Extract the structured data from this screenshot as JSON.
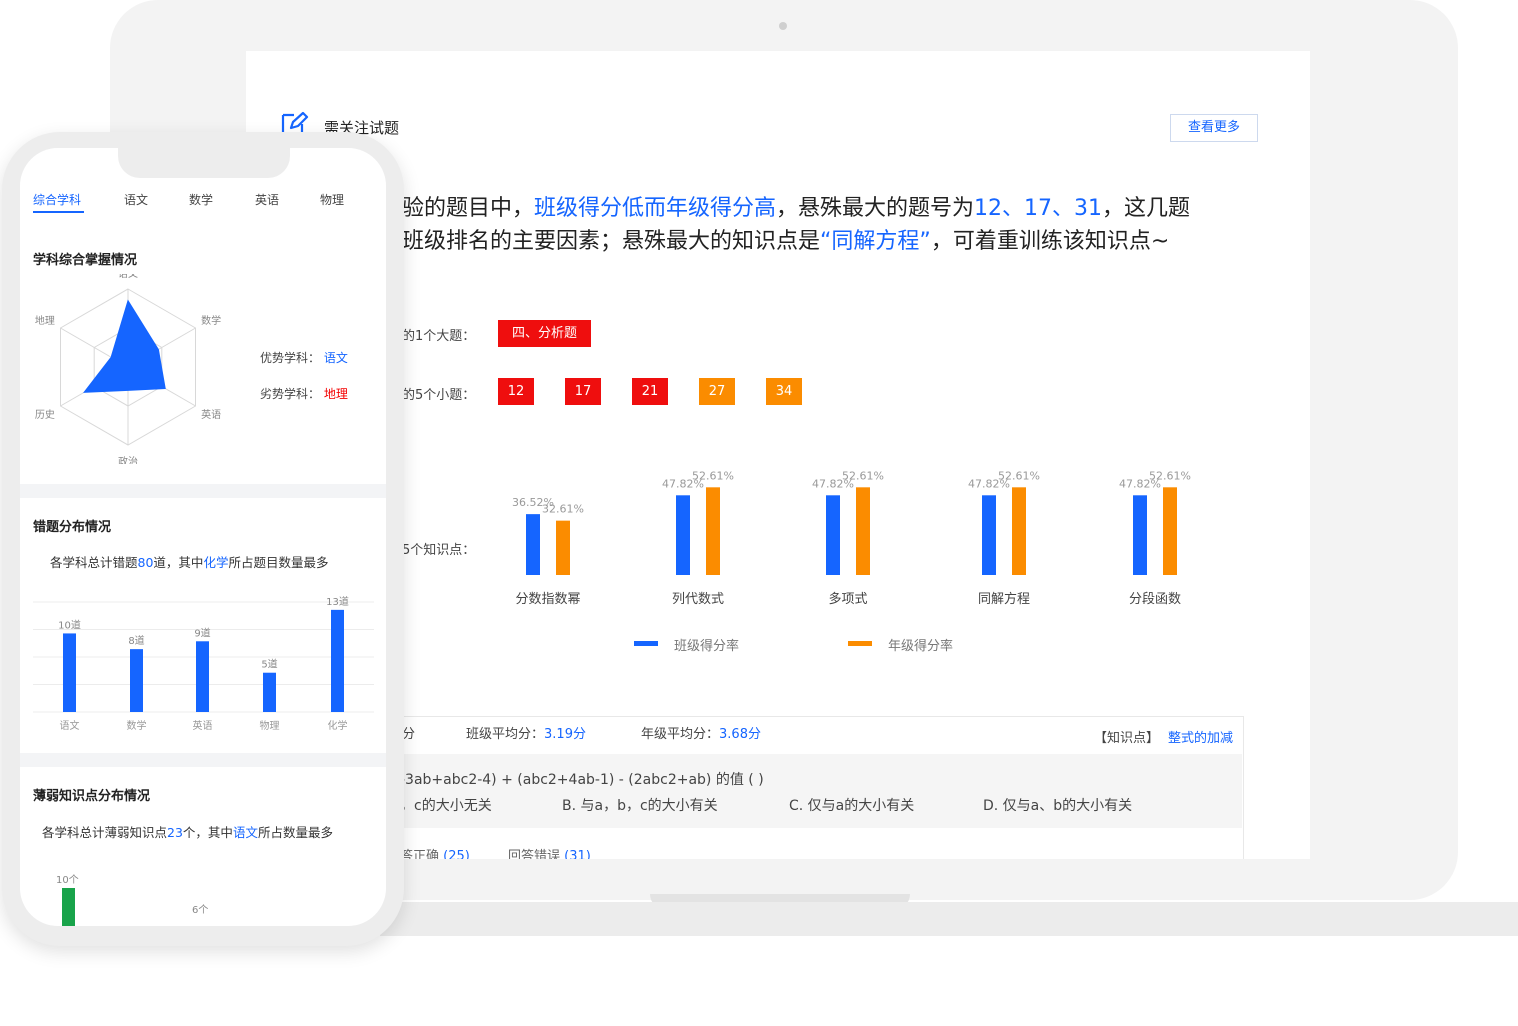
{
  "laptop": {
    "panel_title": "需关注试题",
    "view_more": "查看更多",
    "insight": {
      "l1_a": "验的题目中，",
      "l1_b": "班级得分低而年级得分高",
      "l1_c": "，悬殊最大的题号为",
      "l1_d": "12、17、31",
      "l1_e": "，这几题",
      "l2_a": "班级排名的主要因素；悬殊最大的知识点是",
      "l2_b": "“同解方程”",
      "l2_c": "，可着重训练该知识点~"
    },
    "big_q_label": "的1个大题：",
    "big_q_badge": "四、分析题",
    "small_q_label": "的5个小题：",
    "small_q_badges": [
      {
        "text": "12",
        "color": "red"
      },
      {
        "text": "17",
        "color": "red"
      },
      {
        "text": "21",
        "color": "red"
      },
      {
        "text": "27",
        "color": "orange"
      },
      {
        "text": "34",
        "color": "orange"
      }
    ],
    "kp_label": "5个知识点：",
    "legend_class": "班级得分率",
    "legend_grade": "年级得分率",
    "stats": {
      "partial": "分",
      "class_avg_label": "班级平均分：",
      "class_avg_value": "3.19分",
      "grade_avg_label": "年级平均分：",
      "grade_avg_value": "3.68分",
      "kp_tag": "【知识点】",
      "kp_link": "整式的加减"
    },
    "question": {
      "stem": "-3ab+abc2-4) + (abc2+4ab-1) - (2abc2+ab) 的值 (    )",
      "opt_a": "，c的大小无关",
      "opt_b": "B. 与a，b，c的大小有关",
      "opt_c": "C. 仅与a的大小有关",
      "opt_d": "D. 仅与a、b的大小有关"
    },
    "answer": {
      "correct_label": "答正确",
      "correct_count": "(25)",
      "wrong_label": "回答错误",
      "wrong_count": "(31)"
    }
  },
  "phone": {
    "tabs": [
      "综合学科",
      "语文",
      "数学",
      "英语",
      "物理"
    ],
    "active_tab": 0,
    "mastery": {
      "title": "学科综合掌握情况",
      "strong_label": "优势学科：",
      "strong_value": "语文",
      "weak_label": "劣势学科：",
      "weak_value": "地理"
    },
    "wrong": {
      "title": "错题分布情况",
      "d1": "各学科总计错题",
      "d2": "80",
      "d3": "道，其中",
      "d4": "化学",
      "d5": "所占题目数量最多"
    },
    "weak": {
      "title": "薄弱知识点分布情况",
      "d1": "各学科总计薄弱知识点",
      "d2": "23",
      "d3": "个，其中",
      "d4": "语文",
      "d5": "所占数量最多",
      "bars": [
        {
          "label": "10个",
          "value": 10,
          "color": "#18a34a"
        },
        {
          "label": "6个",
          "value": 6,
          "color": "#18a34a"
        }
      ]
    }
  },
  "chart_data": [
    {
      "type": "bar",
      "categories": [
        "分数指数幂",
        "列代数式",
        "多项式",
        "同解方程",
        "分段函数"
      ],
      "series": [
        {
          "name": "班级得分率",
          "values": [
            36.52,
            47.82,
            47.82,
            47.82,
            47.82
          ],
          "labels": [
            "36.52%",
            "47.82%",
            "47.82%",
            "47.82%",
            "47.82%"
          ],
          "color": "#1565ff"
        },
        {
          "name": "年级得分率",
          "values": [
            32.61,
            52.61,
            52.61,
            52.61,
            52.61
          ],
          "labels": [
            "32.61%",
            "52.61%",
            "52.61%",
            "52.61%",
            "52.61%"
          ],
          "color": "#fb8c00"
        }
      ],
      "ylim": [
        0,
        60
      ],
      "legend": "bottom"
    },
    {
      "type": "radar",
      "categories": [
        "语文",
        "数学",
        "英语",
        "政治",
        "历史",
        "地理"
      ],
      "values": [
        0.85,
        0.45,
        0.55,
        0.3,
        0.65,
        0.25
      ],
      "color": "#1565ff"
    },
    {
      "type": "bar",
      "categories": [
        "语文",
        "数学",
        "英语",
        "物理",
        "化学"
      ],
      "values": [
        10,
        8,
        9,
        5,
        13
      ],
      "labels": [
        "10道",
        "8道",
        "9道",
        "5道",
        "13道"
      ],
      "color": "#1565ff",
      "ylim": [
        0,
        14
      ],
      "grid": true
    }
  ]
}
